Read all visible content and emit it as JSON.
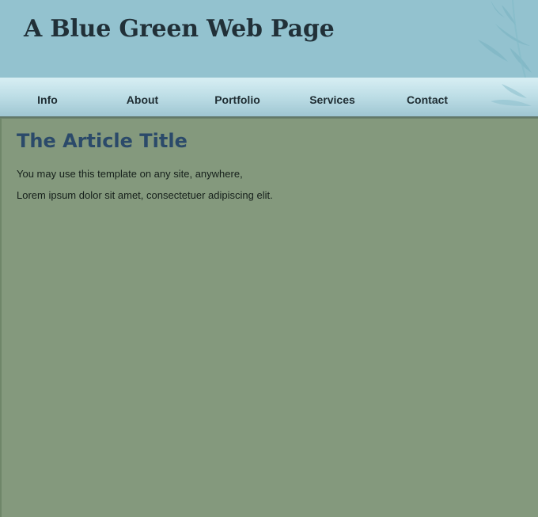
{
  "header": {
    "title": "A Blue Green Web Page"
  },
  "nav": {
    "items": [
      {
        "label": "Info"
      },
      {
        "label": "About"
      },
      {
        "label": "Portfolio"
      },
      {
        "label": "Services"
      },
      {
        "label": "Contact"
      }
    ]
  },
  "article": {
    "title": "The Article Title",
    "paragraphs": [
      "You may use this template on any site, anywhere,",
      "Lorem ipsum dolor sit amet, consectetuer adipiscing elit."
    ]
  },
  "colors": {
    "header_bg": "#93c2cf",
    "nav_gradient_top": "#d7eef3",
    "nav_gradient_bottom": "#9fc6d2",
    "body_bg": "#84997d",
    "title_text": "#213038",
    "article_title": "#2b4a6a"
  },
  "decorations": {
    "header_ornament": "bamboo-leaf-icon",
    "nav_ornament": "bamboo-leaf-icon"
  }
}
